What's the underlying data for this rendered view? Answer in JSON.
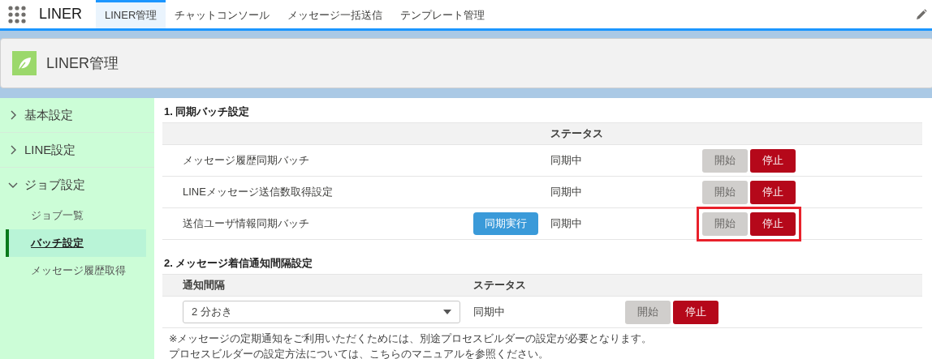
{
  "app": {
    "name": "LINER"
  },
  "tabs": [
    {
      "label": "LINER管理",
      "selected": true
    },
    {
      "label": "チャットコンソール",
      "selected": false
    },
    {
      "label": "メッセージ一括送信",
      "selected": false
    },
    {
      "label": "テンプレート管理",
      "selected": false
    }
  ],
  "page_header": {
    "title": "LINER管理"
  },
  "sidebar": {
    "items": [
      {
        "label": "基本設定",
        "expanded": false
      },
      {
        "label": "LINE設定",
        "expanded": false
      },
      {
        "label": "ジョブ設定",
        "expanded": true,
        "children": [
          {
            "label": "ジョブ一覧",
            "selected": false
          },
          {
            "label": "バッチ設定",
            "selected": true
          },
          {
            "label": "メッセージ履歴取得",
            "selected": false
          }
        ]
      }
    ]
  },
  "batch_section": {
    "title": "1.  同期バッチ設定",
    "status_header": "ステータス",
    "rows": [
      {
        "name": "メッセージ履歴同期バッチ",
        "status": "同期中",
        "start_button": {
          "label": "開始",
          "disabled": true
        },
        "stop_button": {
          "label": "停止",
          "disabled": false
        },
        "highlighted": false
      },
      {
        "name": "LINEメッセージ送信数取得設定",
        "status": "同期中",
        "start_button": {
          "label": "開始",
          "disabled": true
        },
        "stop_button": {
          "label": "停止",
          "disabled": false
        },
        "highlighted": false
      },
      {
        "name": "送信ユーザ情報同期バッチ",
        "sync_button": "同期実行",
        "status": "同期中",
        "start_button": {
          "label": "開始",
          "disabled": true
        },
        "stop_button": {
          "label": "停止",
          "disabled": false
        },
        "highlighted": true
      }
    ]
  },
  "notify_section": {
    "title": "2.  メッセージ着信通知間隔設定",
    "interval_header": "通知間隔",
    "status_header": "ステータス",
    "interval_value": "2 分おき",
    "status": "同期中",
    "start_button": {
      "label": "開始",
      "disabled": true
    },
    "stop_button": {
      "label": "停止",
      "disabled": false
    },
    "notes": [
      "※メッセージの定期通知をご利用いただくためには、別途プロセスビルダーの設定が必要となります。",
      "プロセスビルダーの設定方法については、こちらのマニュアルを参照ください。"
    ]
  }
}
